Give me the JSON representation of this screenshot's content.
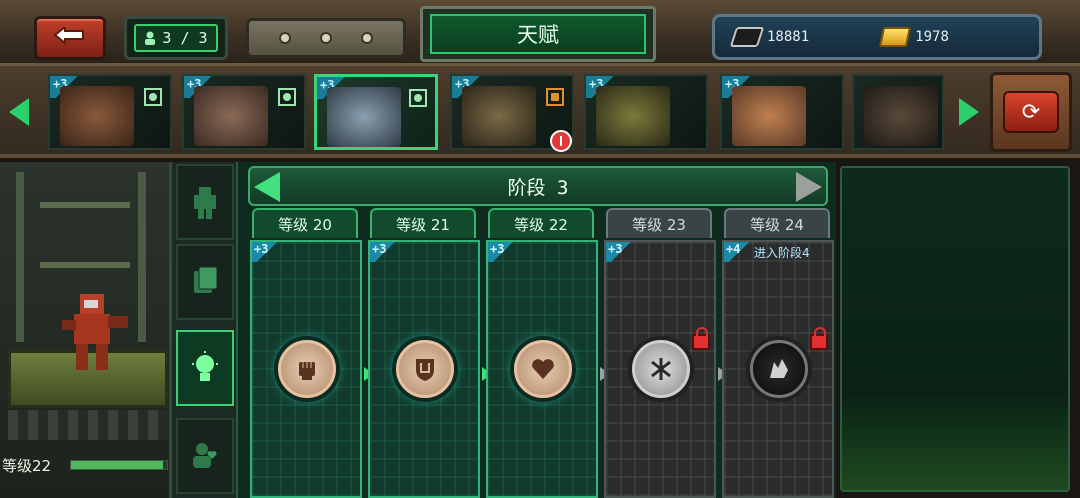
{
  "header": {
    "squad": "3 / 3",
    "title": "天赋",
    "currency": {
      "chips": "18881",
      "gold": "1978"
    }
  },
  "roster": {
    "cards": [
      {
        "plus": "+3",
        "badge": "person",
        "selected": false
      },
      {
        "plus": "+3",
        "badge": "person",
        "selected": false
      },
      {
        "plus": "+3",
        "badge": "person",
        "selected": true
      },
      {
        "plus": "+3",
        "badge": "swap",
        "selected": false
      },
      {
        "plus": "+3",
        "badge": "",
        "selected": false
      },
      {
        "plus": "+3",
        "badge": "",
        "selected": false
      },
      {
        "plus": "",
        "badge": "",
        "selected": false
      }
    ]
  },
  "hero": {
    "level_label": "等级22",
    "xp_progress": 0.96
  },
  "stage": {
    "title": "阶段 3"
  },
  "levels": [
    {
      "label": "等级 20",
      "plus": "+3",
      "state": "open",
      "talent": "fist-icon",
      "note": ""
    },
    {
      "label": "等级 21",
      "plus": "+3",
      "state": "open",
      "talent": "shield-icon",
      "note": ""
    },
    {
      "label": "等级 22",
      "plus": "+3",
      "state": "open",
      "talent": "heart-icon",
      "note": ""
    },
    {
      "label": "等级 23",
      "plus": "+3",
      "state": "locked",
      "talent": "claw-icon",
      "note": ""
    },
    {
      "label": "等级 24",
      "plus": "+4",
      "state": "locked",
      "talent": "wolf-icon",
      "note": "进入阶段4"
    }
  ],
  "colors": {
    "accent": "#3ccf76",
    "locked": "#4e5656",
    "alert": "#e03a3a"
  }
}
